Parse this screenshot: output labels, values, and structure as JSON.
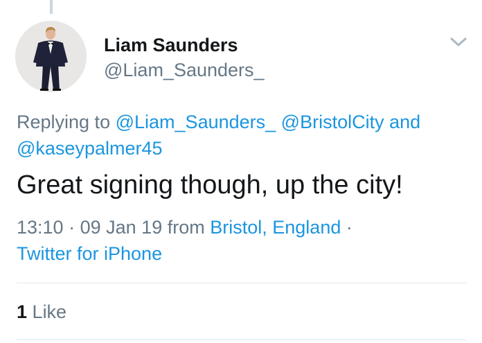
{
  "tweet": {
    "author": {
      "display_name": "Liam Saunders",
      "handle": "@Liam_Saunders_"
    },
    "reply_context": {
      "prefix": "Replying to",
      "mentions": [
        "@Liam_Saunders_",
        "@BristolCity"
      ],
      "conjunction": "and",
      "last_mention": "@kaseypalmer45"
    },
    "text": "Great signing though, up the city!",
    "meta": {
      "time": "13:10",
      "separator": "·",
      "date": "09 Jan 19",
      "from_label": "from",
      "location": "Bristol, England",
      "source": "Twitter for iPhone"
    },
    "engagement": {
      "like_count": "1",
      "like_label": "Like"
    }
  },
  "icons": {
    "menu": "chevron-down-icon"
  },
  "colors": {
    "link": "#1b95e0",
    "secondary_text": "#657786",
    "primary_text": "#14171a",
    "divider": "#e1e8ed"
  }
}
